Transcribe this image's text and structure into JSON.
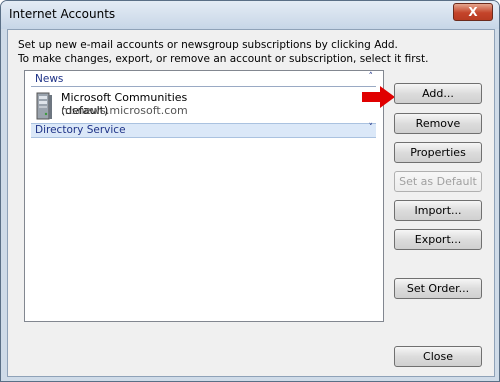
{
  "window": {
    "title": "Internet Accounts",
    "close_glyph": "X"
  },
  "description": [
    "Set up new e-mail accounts or newsgroup subscriptions by clicking Add.",
    "To make changes, export, or remove an account or subscription, select it first."
  ],
  "groups": {
    "news": {
      "label": "News",
      "chevron": "˄"
    },
    "directory": {
      "label": "Directory Service",
      "chevron": "˅"
    }
  },
  "account": {
    "name": "Microsoft Communities (default)",
    "server": "msnews.microsoft.com",
    "icon": "server-icon"
  },
  "buttons": {
    "add": "Add...",
    "remove": "Remove",
    "properties": "Properties",
    "set_default": "Set as Default",
    "import": "Import...",
    "export": "Export...",
    "set_order": "Set Order...",
    "close": "Close"
  },
  "colors": {
    "arrow": "#e00000",
    "group_header": "#1e3287"
  }
}
